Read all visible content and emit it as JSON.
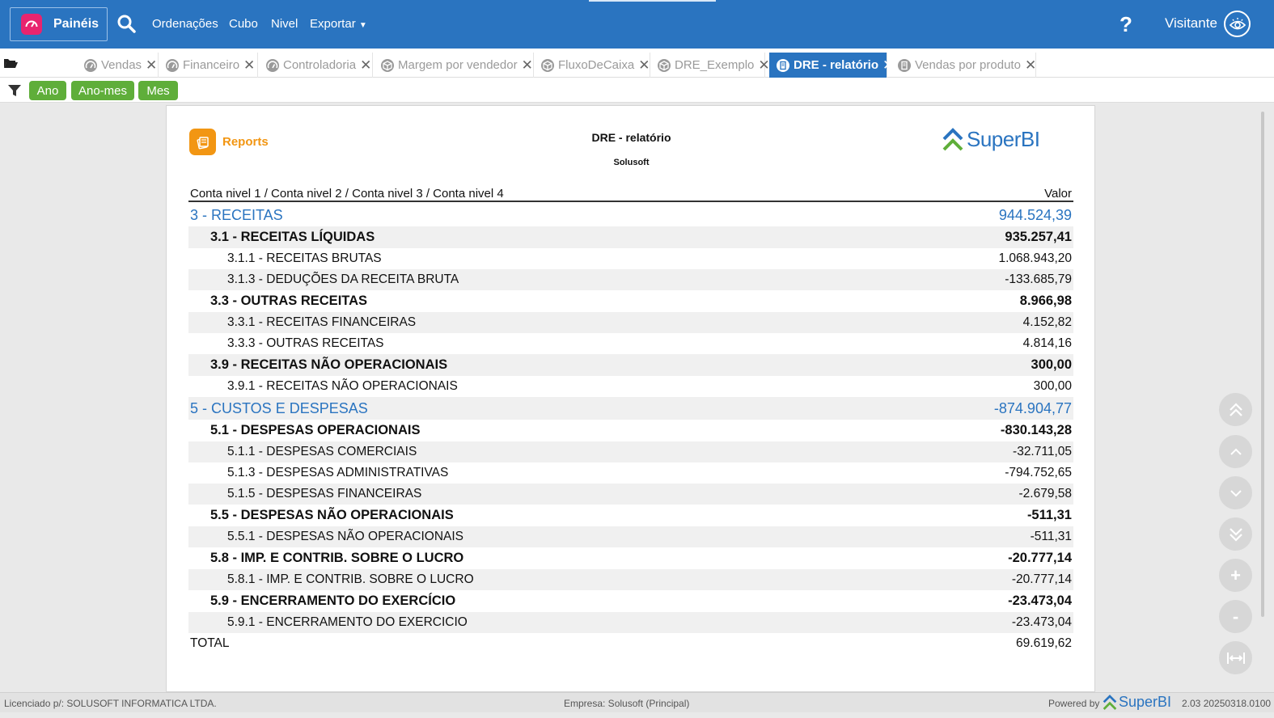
{
  "topbar": {
    "brand_label": "Painéis",
    "nav": [
      {
        "label": "Ordenações",
        "name": "nav-ordenacoes"
      },
      {
        "label": "Cubo",
        "name": "nav-cubo"
      },
      {
        "label": "Nivel",
        "name": "nav-nivel"
      },
      {
        "label": "Exportar",
        "name": "nav-exportar"
      }
    ],
    "help": "?",
    "user": "Visitante"
  },
  "tabs": [
    {
      "label": "Vendas",
      "icon": "gauge-icon",
      "active": false
    },
    {
      "label": "Financeiro",
      "icon": "gauge-icon",
      "active": false
    },
    {
      "label": "Controladoria",
      "icon": "gauge-icon",
      "active": false
    },
    {
      "label": "Margem por vendedor",
      "icon": "cube-icon",
      "active": false
    },
    {
      "label": "FluxoDeCaixa",
      "icon": "cube-icon",
      "active": false
    },
    {
      "label": "DRE_Exemplo",
      "icon": "cube-icon",
      "active": false
    },
    {
      "label": "DRE - relatório",
      "icon": "report-icon",
      "active": true
    },
    {
      "label": "Vendas por produto",
      "icon": "report-icon",
      "active": false
    }
  ],
  "filters": [
    "Ano",
    "Ano-mes",
    "Mes"
  ],
  "report": {
    "logo_text": "Reports",
    "title": "DRE - relatório",
    "subtitle": "Solusoft",
    "brand": "SuperBI",
    "header_left": "Conta nivel 1 / Conta nivel 2 / Conta nivel 3 / Conta nivel 4",
    "header_right": "Valor",
    "rows": [
      {
        "level": 1,
        "label": "3 - RECEITAS",
        "value": "944.524,39"
      },
      {
        "level": 2,
        "label": "3.1 - RECEITAS LÍQUIDAS",
        "value": "935.257,41"
      },
      {
        "level": 3,
        "label": "3.1.1 - RECEITAS BRUTAS",
        "value": "1.068.943,20"
      },
      {
        "level": 3,
        "label": "3.1.3 - DEDUÇÕES DA RECEITA BRUTA",
        "value": "-133.685,79"
      },
      {
        "level": 2,
        "label": "3.3 - OUTRAS RECEITAS",
        "value": "8.966,98"
      },
      {
        "level": 3,
        "label": "3.3.1 - RECEITAS FINANCEIRAS",
        "value": "4.152,82"
      },
      {
        "level": 3,
        "label": "3.3.3 - OUTRAS RECEITAS",
        "value": "4.814,16"
      },
      {
        "level": 2,
        "label": "3.9 - RECEITAS NÃO OPERACIONAIS",
        "value": "300,00"
      },
      {
        "level": 3,
        "label": "3.9.1 - RECEITAS NÃO OPERACIONAIS",
        "value": "300,00"
      },
      {
        "level": 1,
        "label": "5 - CUSTOS E DESPESAS",
        "value": "-874.904,77"
      },
      {
        "level": 2,
        "label": "5.1 - DESPESAS OPERACIONAIS",
        "value": "-830.143,28"
      },
      {
        "level": 3,
        "label": "5.1.1 - DESPESAS COMERCIAIS",
        "value": "-32.711,05"
      },
      {
        "level": 3,
        "label": "5.1.3 - DESPESAS ADMINISTRATIVAS",
        "value": "-794.752,65"
      },
      {
        "level": 3,
        "label": "5.1.5 - DESPESAS FINANCEIRAS",
        "value": "-2.679,58"
      },
      {
        "level": 2,
        "label": "5.5 - DESPESAS NÃO OPERACIONAIS",
        "value": "-511,31"
      },
      {
        "level": 3,
        "label": "5.5.1 - DESPESAS NÃO OPERACIONAIS",
        "value": "-511,31"
      },
      {
        "level": 2,
        "label": "5.8 - IMP. E CONTRIB. SOBRE O LUCRO",
        "value": "-20.777,14"
      },
      {
        "level": 3,
        "label": "5.8.1 - IMP. E CONTRIB. SOBRE O LUCRO",
        "value": "-20.777,14"
      },
      {
        "level": 2,
        "label": "5.9 - ENCERRAMENTO DO EXERCÍCIO",
        "value": "-23.473,04"
      },
      {
        "level": 3,
        "label": "5.9.1 - ENCERRAMENTO DO EXERCICIO",
        "value": "-23.473,04"
      },
      {
        "level": 0,
        "label": "TOTAL",
        "value": "69.619,62"
      }
    ]
  },
  "controls": {
    "zoom_in": "+",
    "zoom_out": "-"
  },
  "footer": {
    "licensed": "Licenciado p/: SOLUSOFT INFORMATICA LTDA.",
    "company": "Empresa: Solusoft (Principal)",
    "powered": "Powered by",
    "brand": "SuperBI",
    "version": "2.03 20250318.0100"
  },
  "colors": {
    "primary": "#2a74c0",
    "brand_pink": "#e8246f",
    "chip_green": "#5fae3a",
    "reports_orange": "#f29613",
    "level1_text": "#2a74c0"
  }
}
